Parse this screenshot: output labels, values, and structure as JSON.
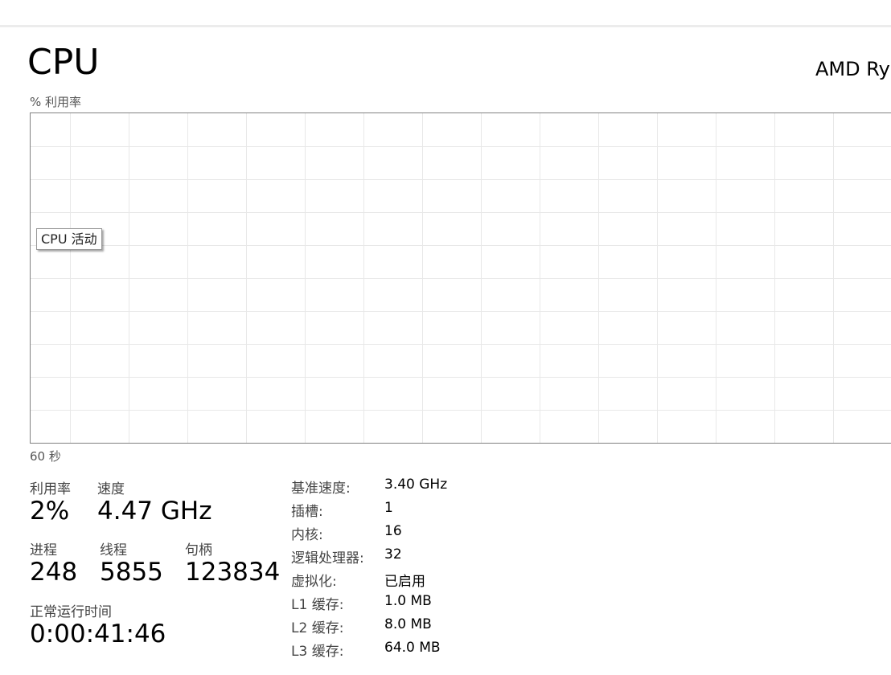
{
  "header": {
    "title": "CPU",
    "cpu_model": "AMD Ry"
  },
  "graph": {
    "y_label": "% 利用率",
    "x_label": "60 秒",
    "tooltip": "CPU 活动",
    "grid_color": "#e8e8e8",
    "border_color": "#808080"
  },
  "stats": {
    "utilization": {
      "label": "利用率",
      "value": "2%"
    },
    "speed": {
      "label": "速度",
      "value": "4.47 GHz"
    },
    "processes": {
      "label": "进程",
      "value": "248"
    },
    "threads": {
      "label": "线程",
      "value": "5855"
    },
    "handles": {
      "label": "句柄",
      "value": "123834"
    },
    "uptime": {
      "label": "正常运行时间",
      "value": "0:00:41:46"
    }
  },
  "specs": [
    {
      "key": "基准速度:",
      "value": "3.40 GHz"
    },
    {
      "key": "插槽:",
      "value": "1"
    },
    {
      "key": "内核:",
      "value": "16"
    },
    {
      "key": "逻辑处理器:",
      "value": "32"
    },
    {
      "key": "虚拟化:",
      "value": "已启用"
    },
    {
      "key": "L1 缓存:",
      "value": "1.0 MB"
    },
    {
      "key": "L2 缓存:",
      "value": "8.0 MB"
    },
    {
      "key": "L3 缓存:",
      "value": "64.0 MB"
    }
  ]
}
